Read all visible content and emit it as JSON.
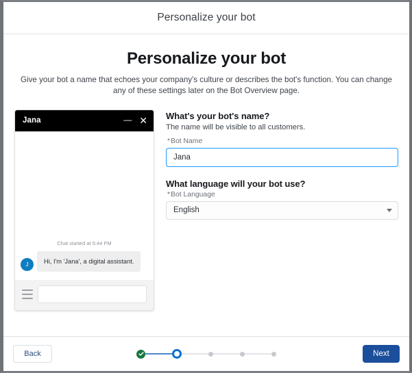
{
  "window": {
    "header_title": "Personalize your bot"
  },
  "intro": {
    "heading": "Personalize your bot",
    "subtitle": "Give your bot a name that echoes your company's culture or describes the bot's function. You can change any of these settings later on the Bot Overview page."
  },
  "chat_preview": {
    "header_title": "Jana",
    "minimize_glyph": "—",
    "close_glyph": "✕",
    "started_label": "Chat started at 5:44 PM",
    "avatar_initial": "J",
    "message": "Hi, I'm 'Jana', a digital assistant.",
    "input_placeholder": "",
    "input_value": ""
  },
  "form": {
    "name_section": {
      "question": "What's your bot's name?",
      "help": "The name will be visible to all customers.",
      "field_label": "Bot Name",
      "required_marker": "*",
      "value": "Jana",
      "placeholder": ""
    },
    "language_section": {
      "question": "What language will your bot use?",
      "field_label": "Bot Language",
      "required_marker": "*",
      "selected": "English",
      "options": [
        "English"
      ]
    }
  },
  "footer": {
    "back_label": "Back",
    "next_label": "Next",
    "steps": [
      {
        "state": "completed"
      },
      {
        "state": "current"
      },
      {
        "state": "pending"
      },
      {
        "state": "pending"
      },
      {
        "state": "pending"
      }
    ]
  },
  "colors": {
    "primary_button": "#1b4f9c",
    "focus_border": "#1b96ff",
    "step_complete": "#16783f",
    "step_current": "#0b6fd1",
    "step_pending": "#c6c9cd",
    "avatar": "#0f7dc2",
    "chat_header": "#000000"
  }
}
